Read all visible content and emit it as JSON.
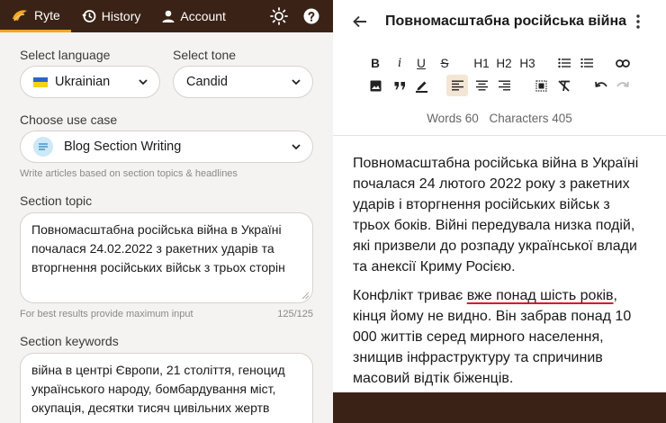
{
  "nav": {
    "ryte_label": "Ryte",
    "history_label": "History",
    "account_label": "Account",
    "icons": [
      "ryte-logo-icon",
      "history-icon",
      "account-icon",
      "theme-sun-icon",
      "help-icon"
    ],
    "accent_color": "#f5a623",
    "bg_color": "#3a2316"
  },
  "form": {
    "language": {
      "label": "Select language",
      "value": "Ukrainian"
    },
    "tone": {
      "label": "Select tone",
      "value": "Candid"
    },
    "use_case": {
      "label": "Choose use case",
      "value": "Blog Section Writing",
      "hint": "Write articles based on section topics & headlines"
    },
    "topic": {
      "label": "Section topic",
      "value": "Повномасштабна російська війна в Україні почалася 24.02.2022 з ракетних ударів та вторгнення російських військ з трьох сторін",
      "hint": "For best results provide maximum input",
      "counter": "125/125"
    },
    "keywords": {
      "label": "Section keywords",
      "value": "війна в центрі Європи, 21 століття, геноцид українського народу, бомбардування міст, окупація, десятки тисяч цивільних жертв"
    }
  },
  "editor": {
    "title": "Повномасштабна російська війна",
    "toolbar": {
      "bold": "B",
      "italic": "i",
      "underline": "U",
      "strike": "S",
      "h1": "H1",
      "h2": "H2",
      "h3": "H3"
    },
    "stats": {
      "words": "Words 60",
      "characters": "Characters 405"
    },
    "paragraph1": "Повномасштабна російська війна в Україні почалася 24 лютого 2022 року з ракетних ударів і вторгнення російських військ з трьох боків. Війні передувала низка подій, які призвели до розпаду української влади та анексії Криму Росією.",
    "paragraph2_before": "Конфлікт триває ",
    "paragraph2_underlined": "вже понад шість років",
    "paragraph2_after": ", кінця йому не видно. Він забрав понад 10 000 життів серед мирного населення, знищив інфраструктуру та спричинив масовий відтік біженців.",
    "underline_color": "#d9182a"
  }
}
